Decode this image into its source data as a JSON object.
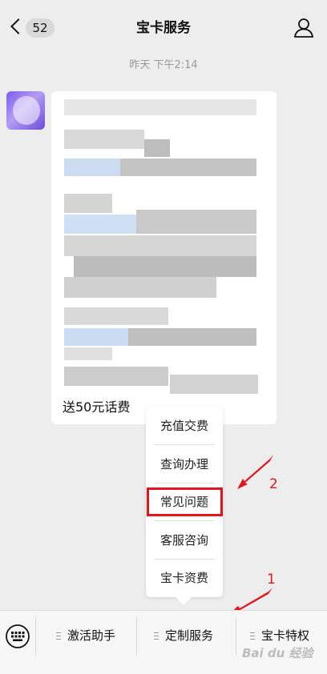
{
  "header": {
    "title": "宝卡服务",
    "unread_count": "52"
  },
  "chat": {
    "timestamp": "昨天 下午2:14",
    "message_visible_text": "送50元话费"
  },
  "popup_menu": {
    "items": [
      "充值交费",
      "查询办理",
      "常见问题",
      "客服咨询",
      "宝卡资费"
    ]
  },
  "bottom_menu": {
    "items": [
      "激活助手",
      "定制服务",
      "宝卡特权"
    ]
  },
  "annotations": {
    "label_1": "1",
    "label_2": "2",
    "color": "#e5141c"
  },
  "watermark": "Bai du 经验",
  "colors": {
    "background": "#ededed",
    "bubble": "#ffffff",
    "annotation_red": "#e5141c"
  }
}
